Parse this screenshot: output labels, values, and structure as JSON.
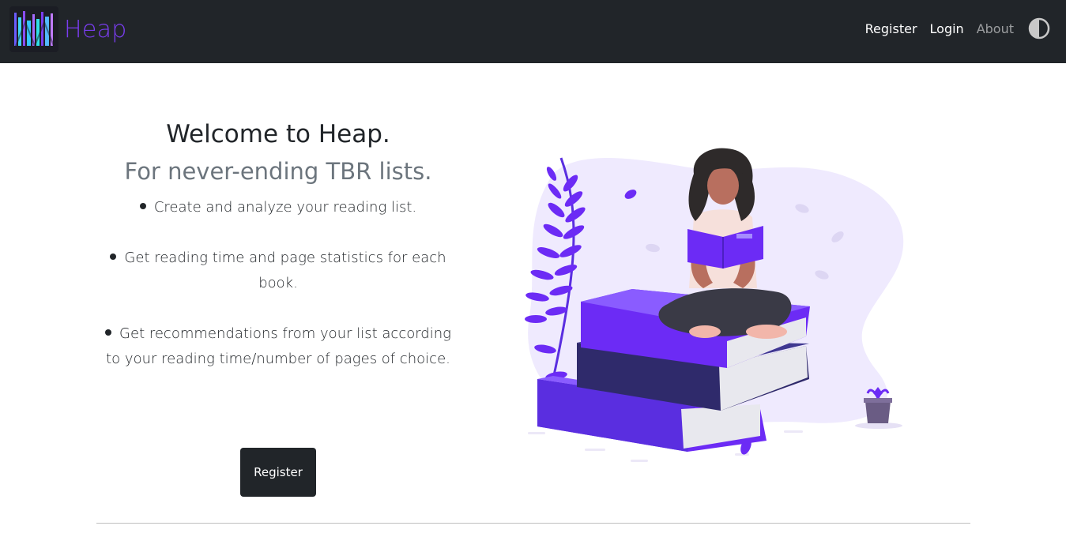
{
  "navbar": {
    "brand_name": "Heap",
    "links": {
      "register": "Register",
      "login": "Login",
      "about": "About"
    },
    "theme_toggle_icon": "contrast-icon",
    "background": "#212529",
    "brand_color": "#7a3df0"
  },
  "hero": {
    "title": "Welcome to Heap.",
    "subtitle": "For never-ending TBR lists.",
    "features": [
      "Create and analyze your reading list.",
      "Get reading time and page statistics for each book.",
      "Get recommendations from your list according to your reading time/number of pages of choice."
    ],
    "cta_label": "Register"
  },
  "illustration": {
    "icon": "woman-reading-on-books-illustration",
    "accent": "#6c2bf5",
    "blob": "#efeafe"
  }
}
